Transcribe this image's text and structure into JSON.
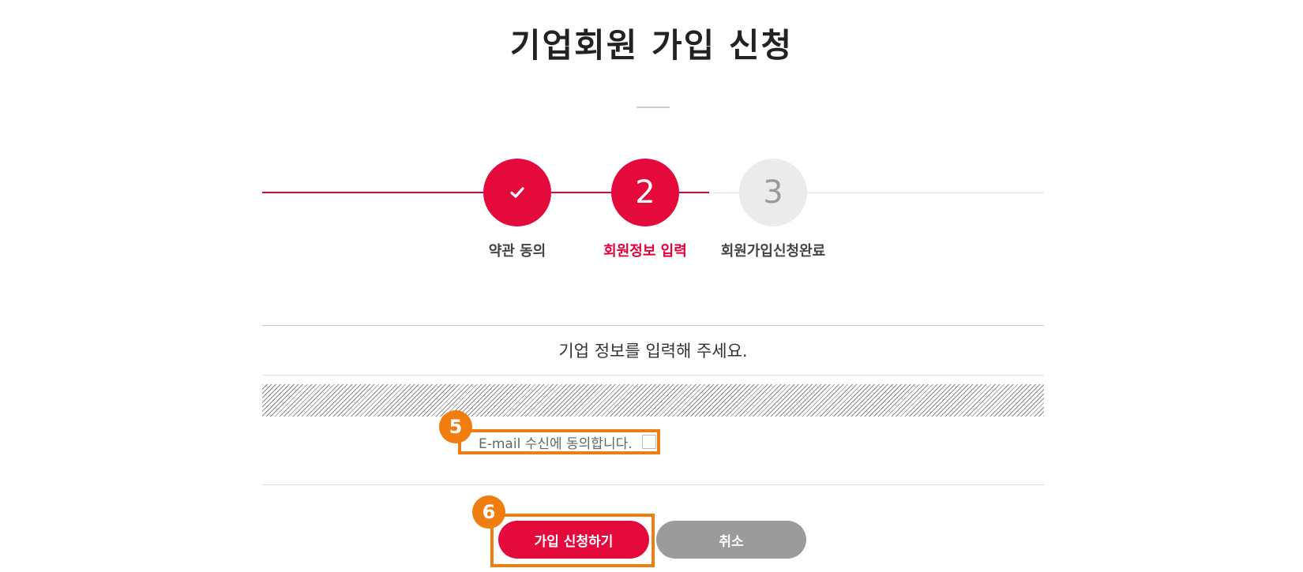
{
  "page": {
    "title": "기업회원 가입 신청"
  },
  "stepper": {
    "current_step": 2,
    "steps": [
      {
        "number": "",
        "icon": "check-icon",
        "label": "약관 동의",
        "state": "done"
      },
      {
        "number": "2",
        "label": "회원정보 입력",
        "state": "current"
      },
      {
        "number": "3",
        "label": "회원가입신청완료",
        "state": "pending"
      }
    ]
  },
  "form": {
    "heading": "기업 정보를 입력해 주세요.",
    "email_consent": {
      "label": "E-mail 수신에 동의합니다.",
      "checked": false
    }
  },
  "annotations": {
    "badge_consent": "5",
    "badge_submit": "6"
  },
  "actions": {
    "submit_label": "가입 신청하기",
    "cancel_label": "취소"
  },
  "colors": {
    "accent": "#e40a3c",
    "pending_step": "#ebebeb",
    "cancel_button": "#9b9b9b",
    "annotation": "#f07d10"
  }
}
